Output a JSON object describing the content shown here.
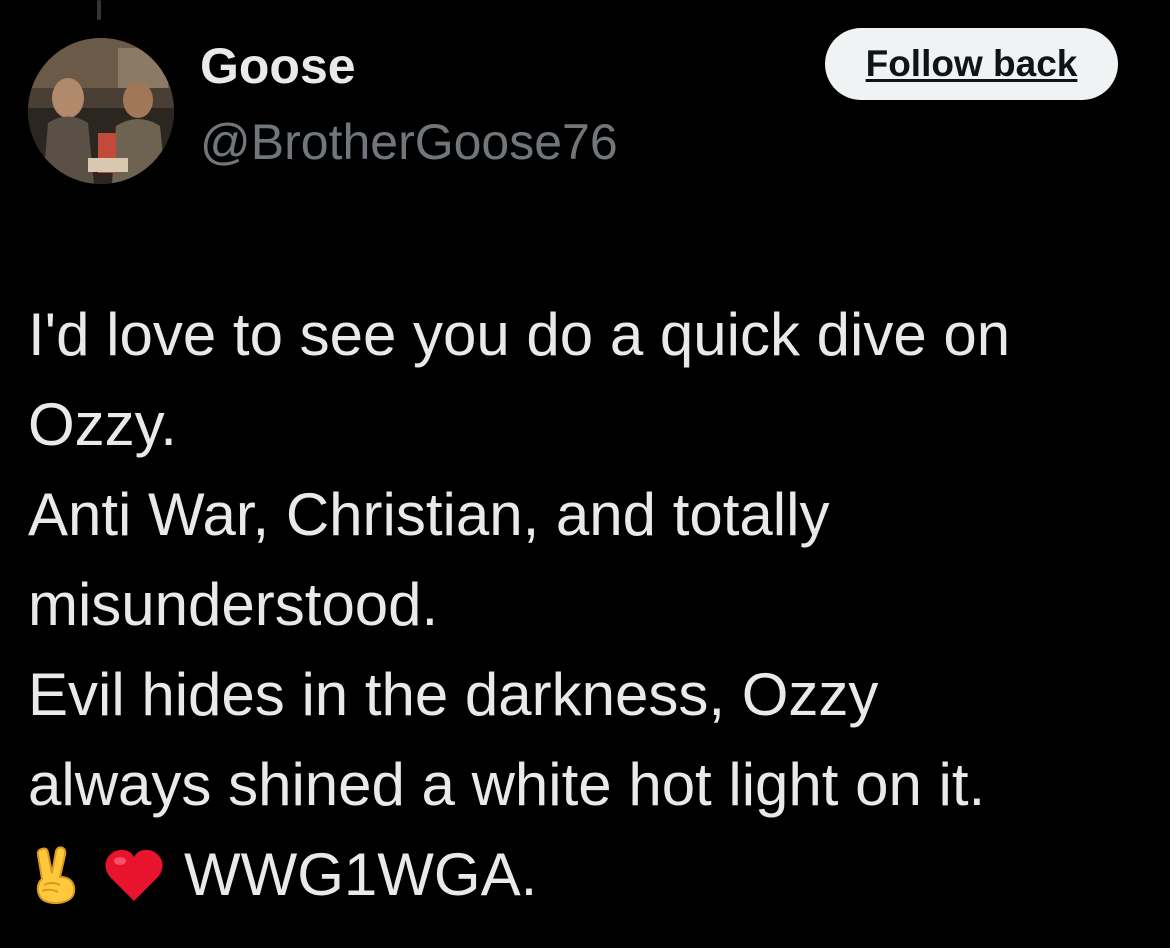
{
  "user": {
    "display_name": "Goose",
    "handle": "@BrotherGoose76",
    "avatar_icon": "profile-photo"
  },
  "actions": {
    "follow_label": "Follow back"
  },
  "tweet": {
    "lines": [
      "I'd love to see you do a quick dive on",
      "Ozzy.",
      "Anti War, Christian, and totally",
      "misunderstood.",
      "Evil hides in the darkness, Ozzy",
      "always shined a white hot light on it."
    ],
    "emojis": [
      "victory-hand-icon",
      "red-heart-icon"
    ],
    "last_line_text": "WWG1WGA."
  },
  "colors": {
    "background": "#000000",
    "primary_text": "#e7e9ea",
    "secondary_text": "#71767b",
    "button_bg": "#eff3f4",
    "button_text": "#0f1419"
  }
}
